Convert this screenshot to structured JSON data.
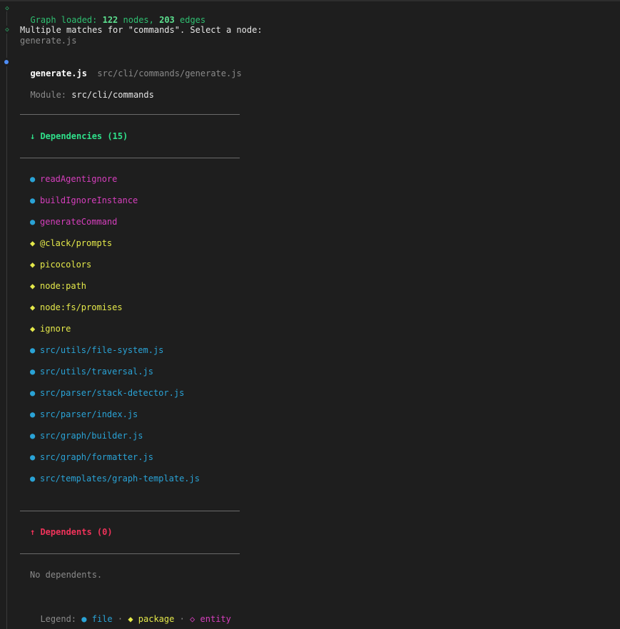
{
  "log": {
    "graph_loaded_prefix": "Graph loaded: ",
    "nodes_count": "122",
    "nodes_word": " nodes, ",
    "edges_count": "203",
    "edges_word": " edges",
    "multiple_matches": "Multiple matches for \"commands\". Select a node:",
    "match_option": "generate.js"
  },
  "node": {
    "name": "generate.js",
    "path": "src/cli/commands/generate.js",
    "module_label": "Module: ",
    "module_value": "src/cli/commands"
  },
  "dependencies": {
    "header": "↓ Dependencies (15)",
    "items": [
      {
        "label": "readAgentignore",
        "kind": "entity"
      },
      {
        "label": "buildIgnoreInstance",
        "kind": "entity"
      },
      {
        "label": "generateCommand",
        "kind": "entity"
      },
      {
        "label": "@clack/prompts",
        "kind": "package"
      },
      {
        "label": "picocolors",
        "kind": "package"
      },
      {
        "label": "node:path",
        "kind": "package"
      },
      {
        "label": "node:fs/promises",
        "kind": "package"
      },
      {
        "label": "ignore",
        "kind": "package"
      },
      {
        "label": "src/utils/file-system.js",
        "kind": "file"
      },
      {
        "label": "src/utils/traversal.js",
        "kind": "file"
      },
      {
        "label": "src/parser/stack-detector.js",
        "kind": "file"
      },
      {
        "label": "src/parser/index.js",
        "kind": "file"
      },
      {
        "label": "src/graph/builder.js",
        "kind": "file"
      },
      {
        "label": "src/graph/formatter.js",
        "kind": "file"
      },
      {
        "label": "src/templates/graph-template.js",
        "kind": "file"
      }
    ]
  },
  "dependents": {
    "header": "↑ Dependents (0)",
    "empty_text": "No dependents."
  },
  "legend": {
    "label": "Legend: ",
    "file_symbol": "●",
    "file_word": "file",
    "sep1": " · ",
    "package_symbol": "◆",
    "package_word": "package",
    "sep2": " · ",
    "entity_symbol": "◇",
    "entity_word": "entity"
  },
  "colors": {
    "background": "#1e1e1e",
    "success": "#2fbf71",
    "entity": "#d63fbd",
    "package": "#e5e94a",
    "file": "#2aa3d6",
    "dependents_header": "#f0335a",
    "dependencies_header": "#2fe08a"
  },
  "icons": {
    "log_marker": "hollow-diamond-icon",
    "active_marker": "filled-dot-icon"
  }
}
